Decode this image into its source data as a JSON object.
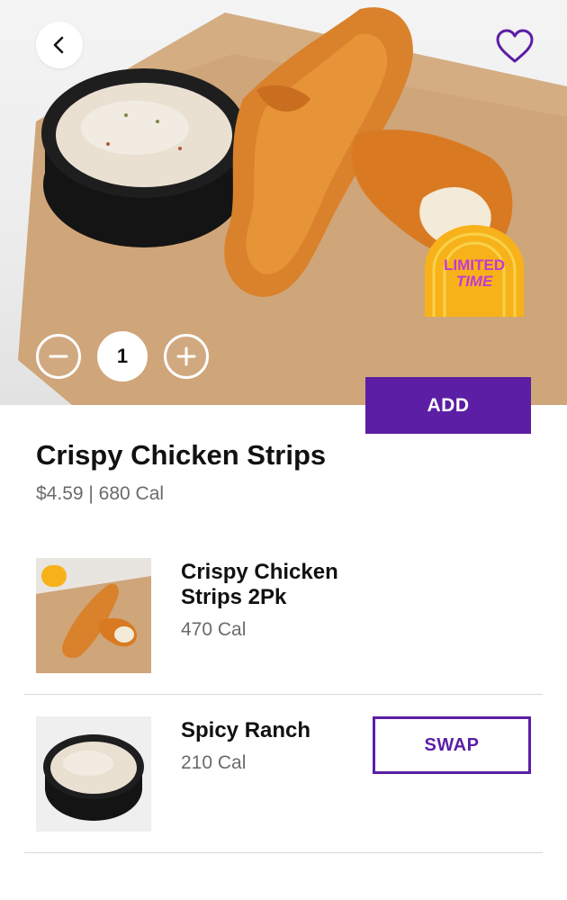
{
  "hero": {
    "back_icon": "chevron-left-icon",
    "favorite_icon": "heart-outline-icon",
    "badge": {
      "line1": "LIMITED",
      "line2": "TIME"
    },
    "quantity": "1",
    "add_label": "ADD"
  },
  "product": {
    "title": "Crispy Chicken Strips",
    "subtitle": "$4.59 | 680 Cal"
  },
  "items": [
    {
      "name": "Crispy Chicken Strips 2Pk",
      "calories": "470 Cal"
    },
    {
      "name": "Spicy Ranch",
      "calories": "210 Cal",
      "action_label": "SWAP"
    }
  ],
  "colors": {
    "accent": "#5b1ea5",
    "muted_text": "#6b6b6b",
    "divider": "#d7d7d7"
  }
}
